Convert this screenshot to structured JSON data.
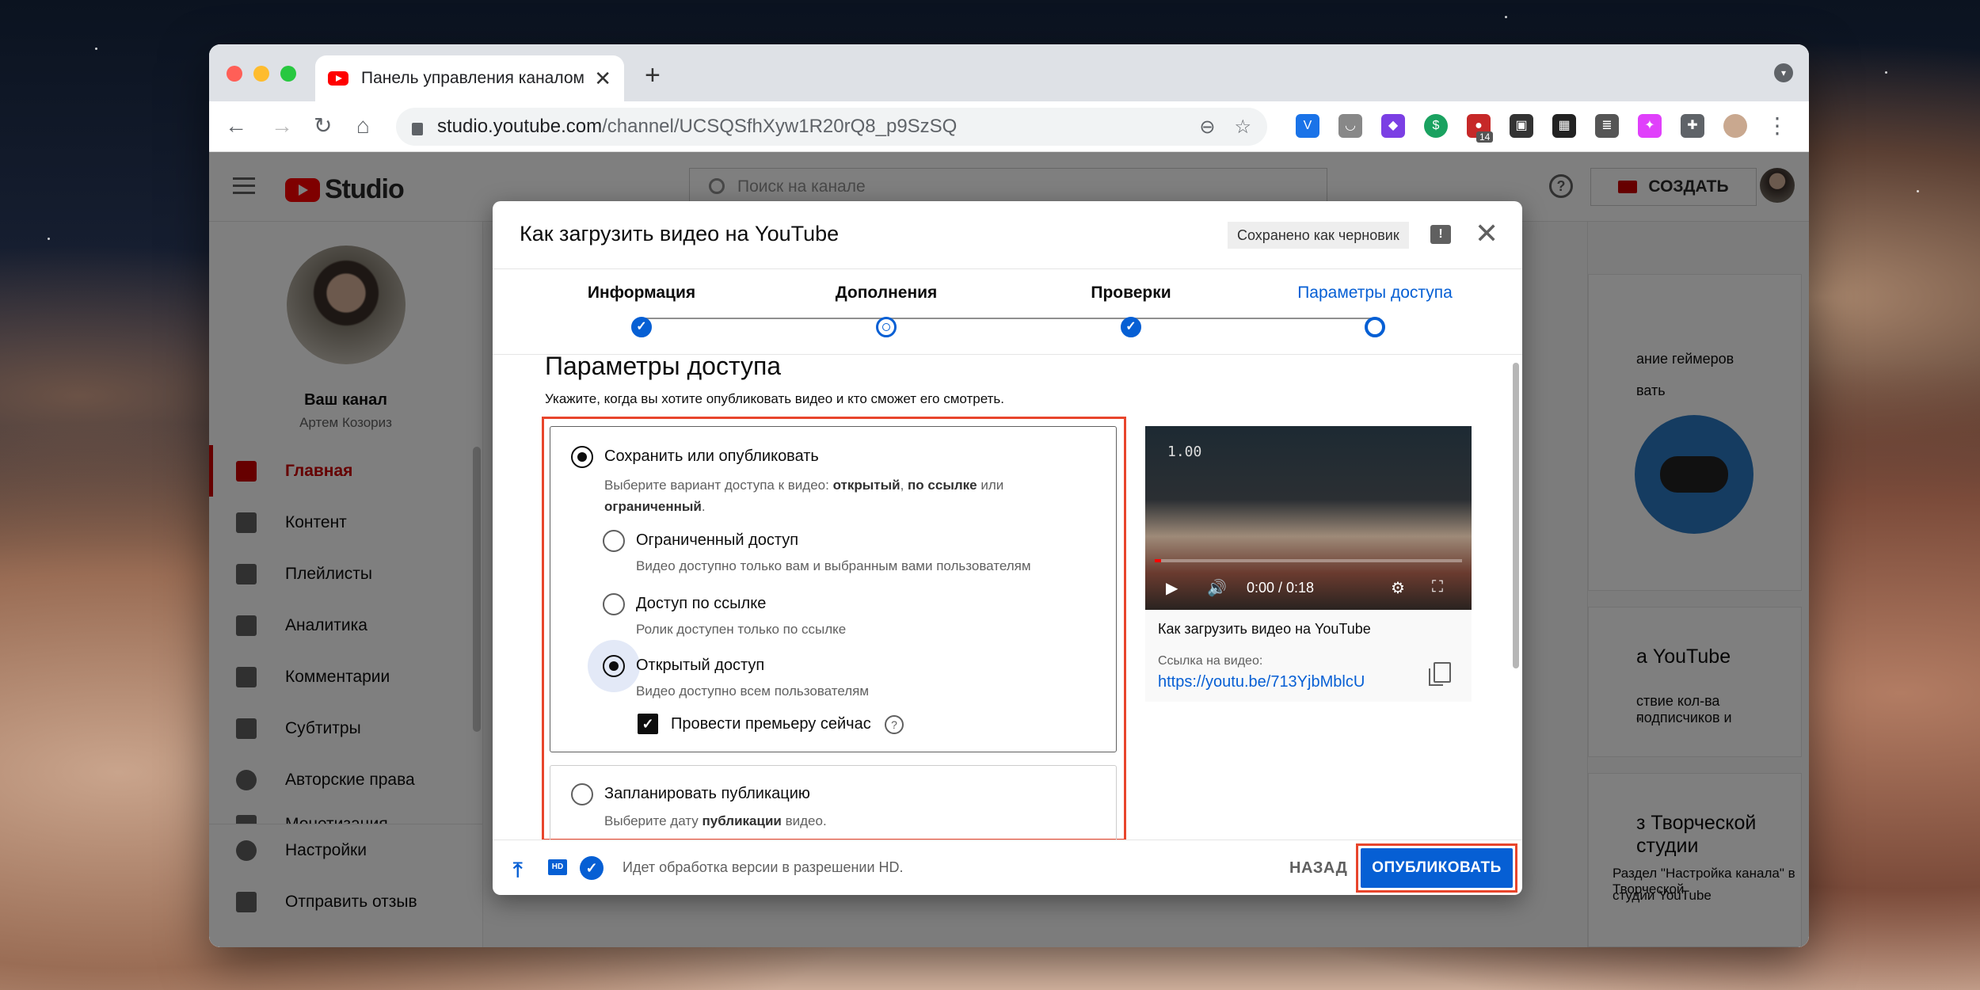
{
  "browser": {
    "tab_title": "Панель управления каналом",
    "tab_close": "✕",
    "new_tab": "+",
    "url_host": "studio.youtube.com",
    "url_path": "/channel/UCSQSfhXyw1R20rQ8_p9SzSQ",
    "ext_badge": "14"
  },
  "header": {
    "logo_text": "Studio",
    "search_placeholder": "Поиск на канале",
    "help": "?",
    "create_label": "СОЗДАТЬ"
  },
  "sidebar": {
    "channel_name": "Ваш канал",
    "channel_owner": "Артем Козориз",
    "items": [
      {
        "label": "Главная",
        "icon": "dashboard-icon",
        "active": true
      },
      {
        "label": "Контент",
        "icon": "video-library-icon"
      },
      {
        "label": "Плейлисты",
        "icon": "playlist-icon"
      },
      {
        "label": "Аналитика",
        "icon": "analytics-icon"
      },
      {
        "label": "Комментарии",
        "icon": "comment-icon"
      },
      {
        "label": "Субтитры",
        "icon": "subtitles-icon"
      },
      {
        "label": "Авторские права",
        "icon": "copyright-icon"
      },
      {
        "label": "Монетизация",
        "icon": "monetization-icon"
      }
    ],
    "bottom": [
      {
        "label": "Настройки",
        "icon": "settings-icon"
      },
      {
        "label": "Отправить отзыв",
        "icon": "feedback-icon"
      }
    ]
  },
  "right_panel": {
    "card1_line1": "ание геймеров",
    "card1_line2": "вать",
    "card2_title": "а YouTube",
    "card2_line1": "ствие кол-ва подписчиков и",
    "card2_line2": "\"",
    "card3_title": "з Творческой студии",
    "card3_text1": "Раздел \"Настройка канала\" в Творческой",
    "card3_text2": "студии YouTube"
  },
  "modal": {
    "title": "Как загрузить видео на YouTube",
    "draft_badge": "Сохранено как черновик",
    "close": "✕",
    "steps": [
      {
        "label": "Информация",
        "state": "done"
      },
      {
        "label": "Дополнения",
        "state": "visited"
      },
      {
        "label": "Проверки",
        "state": "done"
      },
      {
        "label": "Параметры доступа",
        "state": "current"
      }
    ],
    "section_title": "Параметры доступа",
    "section_sub": "Укажите, когда вы хотите опубликовать видео и кто сможет его смотреть.",
    "save_option": {
      "label": "Сохранить или опубликовать",
      "desc_pre": "Выберите вариант доступа к видео: ",
      "desc_b1": "открытый",
      "desc_sep": ", ",
      "desc_b2": "по ссылке",
      "desc_mid": " или",
      "desc_b3": "ограниченный",
      "desc_end": "."
    },
    "sub_options": [
      {
        "label": "Ограниченный доступ",
        "desc": "Видео доступно только вам и выбранным вами пользователям",
        "selected": false
      },
      {
        "label": "Доступ по ссылке",
        "desc": "Ролик доступен только по ссылке",
        "selected": false
      },
      {
        "label": "Открытый доступ",
        "desc": "Видео доступно всем пользователям",
        "selected": true
      }
    ],
    "premiere_label": "Провести премьеру сейчас",
    "premiere_checked": true,
    "schedule": {
      "label": "Запланировать публикацию",
      "desc_pre": "Выберите дату ",
      "desc_b": "публикации",
      "desc_end": " видео."
    },
    "video": {
      "overlay_time": "1.00",
      "time": "0:00 / 0:18",
      "progress": 0.02,
      "title": "Как загрузить видео на YouTube",
      "link_label": "Ссылка на видео:",
      "link": "https://youtu.be/713YjbMblcU"
    },
    "footer": {
      "hd": "HD",
      "status": "Идет обработка версии в разрешении HD.",
      "back": "НАЗАД",
      "publish": "ОПУБЛИКОВАТЬ"
    }
  },
  "colors": {
    "accent_blue": "#065fd4",
    "yt_red": "#cc0000",
    "highlight": "#e8452c"
  }
}
